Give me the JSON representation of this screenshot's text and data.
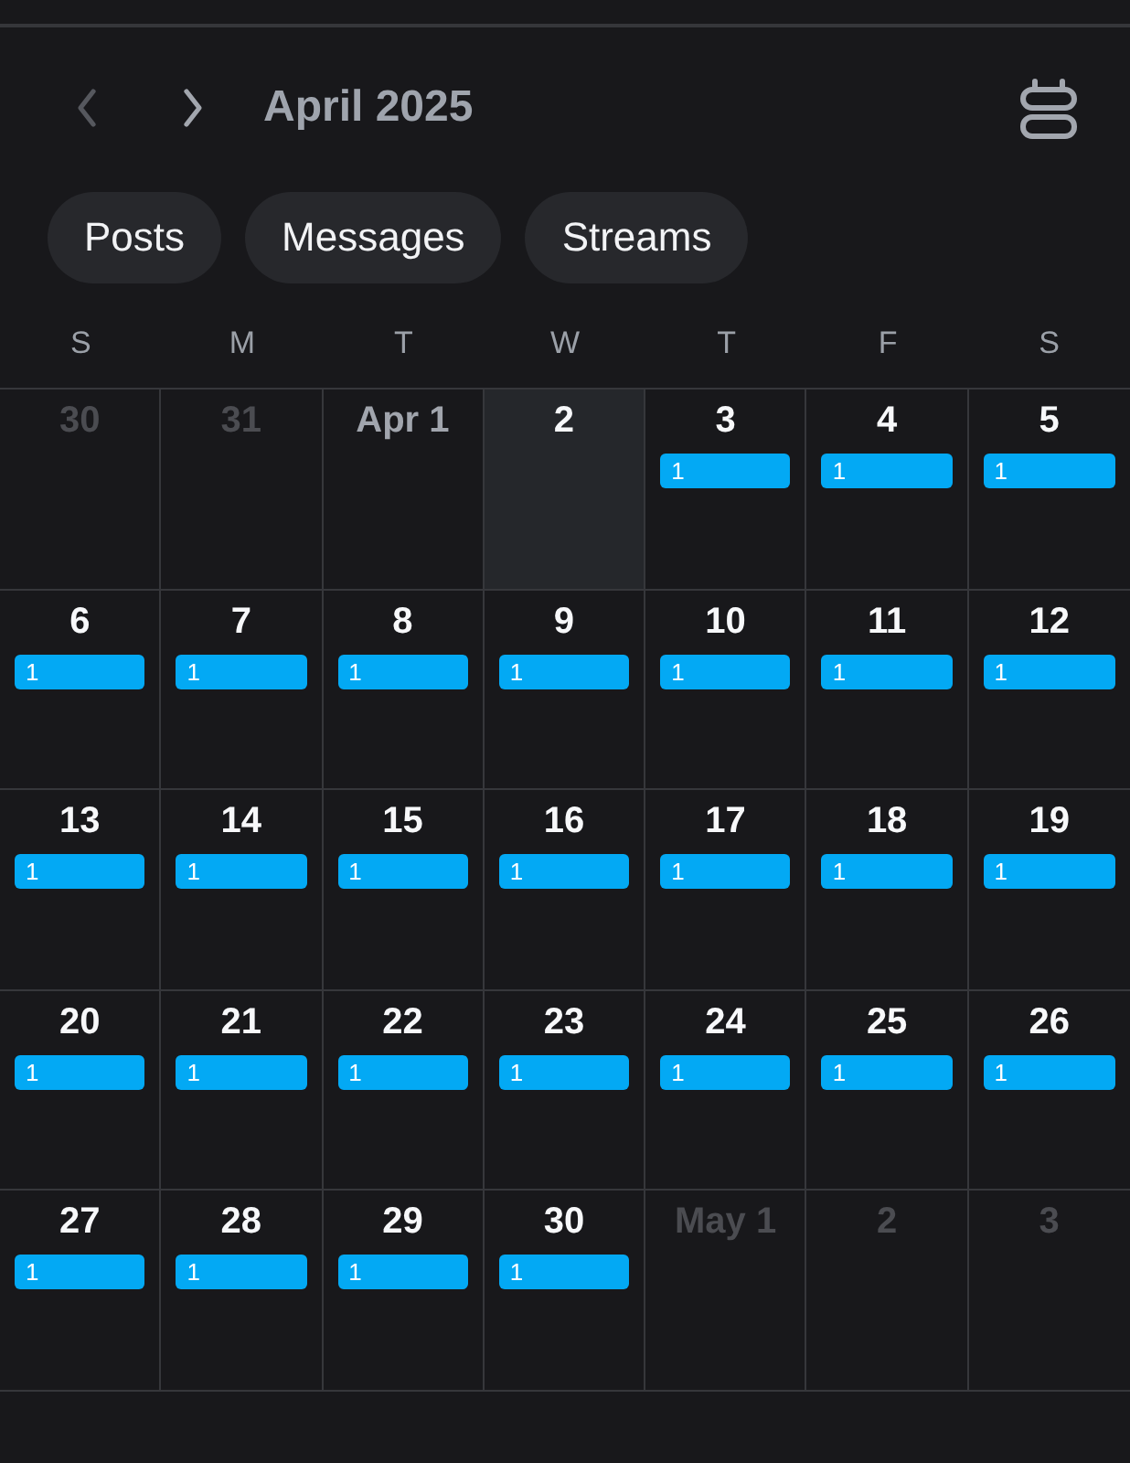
{
  "header": {
    "nav": [
      {
        "kind": "prev",
        "disabled": true
      },
      {
        "kind": "next",
        "disabled": false
      }
    ],
    "title": "April 2025"
  },
  "filters": [
    {
      "label": "Posts"
    },
    {
      "label": "Messages"
    },
    {
      "label": "Streams"
    }
  ],
  "weekdays": [
    "S",
    "M",
    "T",
    "W",
    "T",
    "F",
    "S"
  ],
  "weeks": [
    {
      "days": [
        {
          "label": "30",
          "kind": "other_month",
          "selected": false
        },
        {
          "label": "31",
          "kind": "other_month",
          "selected": false
        },
        {
          "label": "Apr 1",
          "kind": "past",
          "selected": false
        },
        {
          "label": "2",
          "kind": "day",
          "selected": true
        },
        {
          "label": "3",
          "kind": "day",
          "selected": false,
          "event_count": "1"
        },
        {
          "label": "4",
          "kind": "day",
          "selected": false,
          "event_count": "1"
        },
        {
          "label": "5",
          "kind": "day",
          "selected": false,
          "event_count": "1"
        }
      ]
    },
    {
      "days": [
        {
          "label": "6",
          "kind": "day",
          "selected": false,
          "event_count": "1"
        },
        {
          "label": "7",
          "kind": "day",
          "selected": false,
          "event_count": "1"
        },
        {
          "label": "8",
          "kind": "day",
          "selected": false,
          "event_count": "1"
        },
        {
          "label": "9",
          "kind": "day",
          "selected": false,
          "event_count": "1"
        },
        {
          "label": "10",
          "kind": "day",
          "selected": false,
          "event_count": "1"
        },
        {
          "label": "11",
          "kind": "day",
          "selected": false,
          "event_count": "1"
        },
        {
          "label": "12",
          "kind": "day",
          "selected": false,
          "event_count": "1"
        }
      ]
    },
    {
      "days": [
        {
          "label": "13",
          "kind": "day",
          "selected": false,
          "event_count": "1"
        },
        {
          "label": "14",
          "kind": "day",
          "selected": false,
          "event_count": "1"
        },
        {
          "label": "15",
          "kind": "day",
          "selected": false,
          "event_count": "1"
        },
        {
          "label": "16",
          "kind": "day",
          "selected": false,
          "event_count": "1"
        },
        {
          "label": "17",
          "kind": "day",
          "selected": false,
          "event_count": "1"
        },
        {
          "label": "18",
          "kind": "day",
          "selected": false,
          "event_count": "1"
        },
        {
          "label": "19",
          "kind": "day",
          "selected": false,
          "event_count": "1"
        }
      ]
    },
    {
      "days": [
        {
          "label": "20",
          "kind": "day",
          "selected": false,
          "event_count": "1"
        },
        {
          "label": "21",
          "kind": "day",
          "selected": false,
          "event_count": "1"
        },
        {
          "label": "22",
          "kind": "day",
          "selected": false,
          "event_count": "1"
        },
        {
          "label": "23",
          "kind": "day",
          "selected": false,
          "event_count": "1"
        },
        {
          "label": "24",
          "kind": "day",
          "selected": false,
          "event_count": "1"
        },
        {
          "label": "25",
          "kind": "day",
          "selected": false,
          "event_count": "1"
        },
        {
          "label": "26",
          "kind": "day",
          "selected": false,
          "event_count": "1"
        }
      ]
    },
    {
      "days": [
        {
          "label": "27",
          "kind": "day",
          "selected": false,
          "event_count": "1"
        },
        {
          "label": "28",
          "kind": "day",
          "selected": false,
          "event_count": "1"
        },
        {
          "label": "29",
          "kind": "day",
          "selected": false,
          "event_count": "1"
        },
        {
          "label": "30",
          "kind": "day",
          "selected": false,
          "event_count": "1"
        },
        {
          "label": "May 1",
          "kind": "other_month",
          "selected": false
        },
        {
          "label": "2",
          "kind": "other_month",
          "selected": false
        },
        {
          "label": "3",
          "kind": "other_month",
          "selected": false
        }
      ]
    }
  ]
}
